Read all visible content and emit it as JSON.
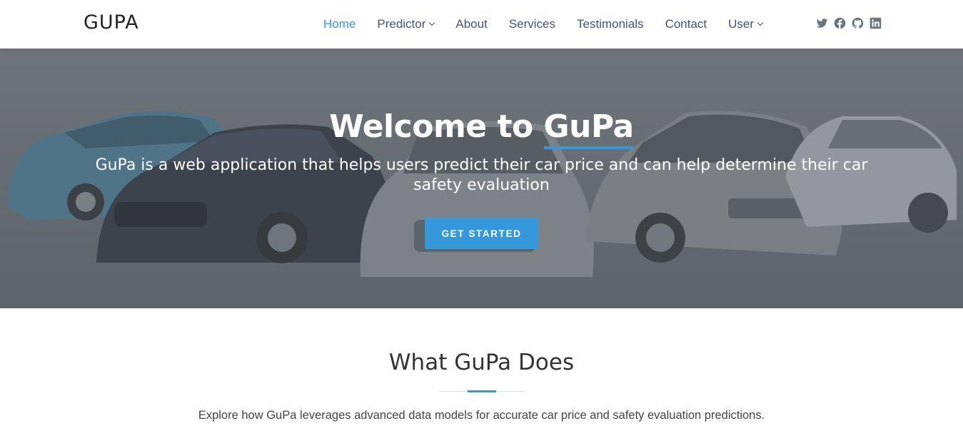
{
  "header": {
    "logo": "GUPA",
    "nav": [
      {
        "label": "Home",
        "active": true,
        "dropdown": false
      },
      {
        "label": "Predictor",
        "active": false,
        "dropdown": true
      },
      {
        "label": "About",
        "active": false,
        "dropdown": false
      },
      {
        "label": "Services",
        "active": false,
        "dropdown": false
      },
      {
        "label": "Testimonials",
        "active": false,
        "dropdown": false
      },
      {
        "label": "Contact",
        "active": false,
        "dropdown": false
      },
      {
        "label": "User",
        "active": false,
        "dropdown": true
      }
    ],
    "socials": [
      "twitter-icon",
      "facebook-icon",
      "github-icon",
      "linkedin-icon"
    ]
  },
  "hero": {
    "title_prefix": "Welcome to ",
    "title_brand": "GuPa",
    "subtitle": "GuPa is a web application that helps users predict their car price and can help determine their car safety evaluation",
    "cta_label": "GET STARTED"
  },
  "section": {
    "title": "What GuPa Does",
    "description": "Explore how GuPa leverages advanced data models for accurate car price and safety evaluation predictions."
  },
  "colors": {
    "accent": "#3498db",
    "nav_text": "#47536e",
    "hero_overlay": "#6b7378"
  }
}
